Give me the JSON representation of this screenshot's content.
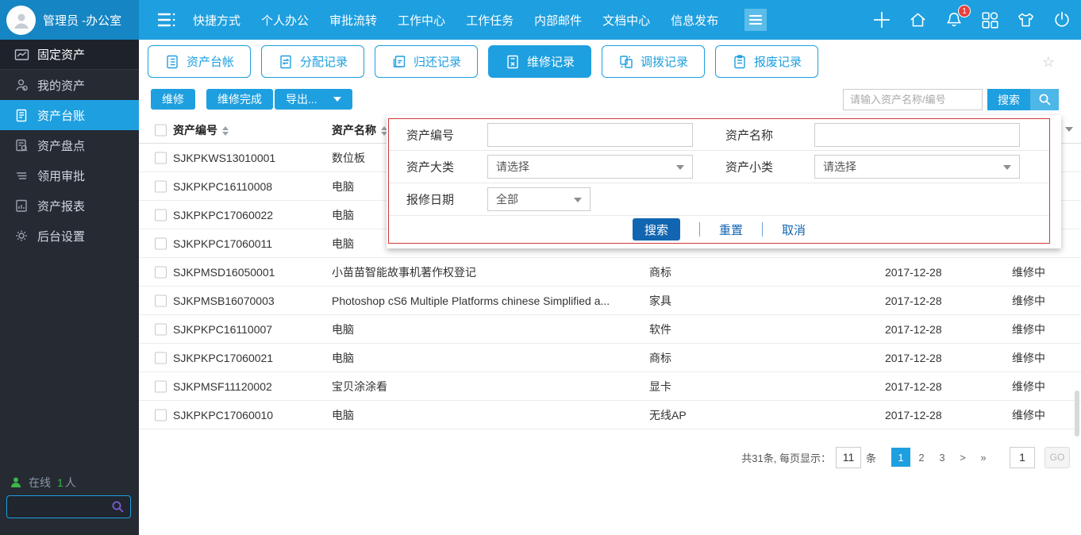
{
  "topbar": {
    "user_name": "管理员 -办公室",
    "menu_items": [
      "快捷方式",
      "个人办公",
      "审批流转",
      "工作中心",
      "工作任务",
      "内部邮件",
      "文档中心",
      "信息发布"
    ],
    "notification_count": "1"
  },
  "sidebar": {
    "items": [
      {
        "label": "固定资产"
      },
      {
        "label": "我的资产"
      },
      {
        "label": "资产台账"
      },
      {
        "label": "资产盘点"
      },
      {
        "label": "领用审批"
      },
      {
        "label": "资产报表"
      },
      {
        "label": "后台设置"
      }
    ],
    "online_label": "在线",
    "online_count": "1",
    "online_unit": "人"
  },
  "tabs": [
    {
      "label": "资产台帐"
    },
    {
      "label": "分配记录"
    },
    {
      "label": "归还记录"
    },
    {
      "label": "维修记录",
      "active": true
    },
    {
      "label": "调拨记录"
    },
    {
      "label": "报废记录"
    }
  ],
  "toolbar": {
    "repair_label": "维修",
    "repair_done_label": "维修完成",
    "export_label": "导出...",
    "search_placeholder": "请输入资产名称/编号",
    "search_label": "搜索"
  },
  "filter": {
    "asset_no_label": "资产编号",
    "asset_no_value": "",
    "asset_name_label": "资产名称",
    "asset_name_value": "",
    "category_label": "资产大类",
    "category_value": "请选择",
    "subcategory_label": "资产小类",
    "subcategory_value": "请选择",
    "date_label": "报修日期",
    "date_value": "全部",
    "search_label": "搜索",
    "reset_label": "重置",
    "cancel_label": "取消"
  },
  "table": {
    "headers": {
      "no": "资产编号",
      "name": "资产名称"
    },
    "rows": [
      {
        "no": "SJKPKWS13010001",
        "name": "数位板",
        "category": "",
        "date": "",
        "status": ""
      },
      {
        "no": "SJKPKPC16110008",
        "name": "电脑",
        "category": "",
        "date": "",
        "status": ""
      },
      {
        "no": "SJKPKPC17060022",
        "name": "电脑",
        "category": "",
        "date": "",
        "status": ""
      },
      {
        "no": "SJKPKPC17060011",
        "name": "电脑",
        "category": "",
        "date": "",
        "status": ""
      },
      {
        "no": "SJKPMSD16050001",
        "name": "小苗苗智能故事机著作权登记",
        "category": "商标",
        "date": "2017-12-28",
        "status": "维修中"
      },
      {
        "no": "SJKPMSB16070003",
        "name": "Photoshop cS6 Multiple Platforms chinese Simplified a...",
        "category": "家具",
        "date": "2017-12-28",
        "status": "维修中"
      },
      {
        "no": "SJKPKPC16110007",
        "name": "电脑",
        "category": "软件",
        "date": "2017-12-28",
        "status": "维修中"
      },
      {
        "no": "SJKPKPC17060021",
        "name": "电脑",
        "category": "商标",
        "date": "2017-12-28",
        "status": "维修中"
      },
      {
        "no": "SJKPMSF11120002",
        "name": "宝贝涂涂看",
        "category": "显卡",
        "date": "2017-12-28",
        "status": "维修中"
      },
      {
        "no": "SJKPKPC17060010",
        "name": "电脑",
        "category": "无线AP",
        "date": "2017-12-28",
        "status": "维修中"
      }
    ]
  },
  "pagination": {
    "total_text": "共31条, 每页显示：",
    "page_size": "11",
    "unit": "条",
    "pages": [
      "1",
      "2",
      "3"
    ],
    "next_label": ">",
    "last_label": "»",
    "jump_value": "1",
    "go_label": "GO"
  },
  "colors": {
    "accent_blue": "#1e9fdf",
    "deep_blue": "#1266b1",
    "panel_border_red": "#d03a3a",
    "online_green": "#3cb54a",
    "badge_red": "#e8413c"
  }
}
